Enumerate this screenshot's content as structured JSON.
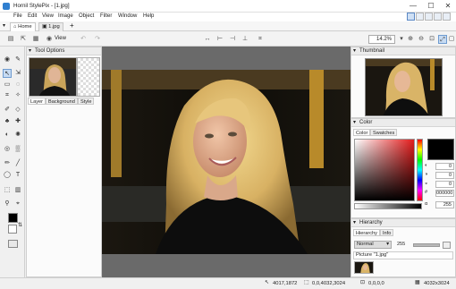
{
  "window": {
    "title": "Hornil StylePix - [1.jpg]",
    "minimize": "—",
    "maximize": "☐",
    "close": "✕"
  },
  "menu": [
    "File",
    "Edit",
    "View",
    "Image",
    "Object",
    "Filter",
    "Window",
    "Help"
  ],
  "doc_tabs": [
    {
      "label": "Home"
    },
    {
      "label": "1.jpg"
    }
  ],
  "tab_add": "+",
  "toolbar": {
    "view_label": "View",
    "zoom_value": "14.2%"
  },
  "tool_options": {
    "title": "Tool Options",
    "tabs": [
      "Layer",
      "Background",
      "Style"
    ]
  },
  "thumbnail": {
    "title": "Thumbnail"
  },
  "color": {
    "title": "Color",
    "tabs": [
      "Color",
      "Swatches"
    ],
    "foreground": "#000000",
    "hex_value": "000000",
    "channel_values": [
      "0",
      "0",
      "0",
      "0",
      "0",
      "255"
    ]
  },
  "hierarchy": {
    "title": "Hierarchy",
    "tabs": [
      "Hierarchy",
      "Info"
    ],
    "blend_mode": "Normal",
    "opacity": "255",
    "item": "Picture \"1.jpg\""
  },
  "status": {
    "cursor_pos": "4017,1872",
    "selection": "0,0,4032,3024",
    "offset": "0,0,0,0",
    "image_size": "4032x3024"
  },
  "colors": {
    "accent": "#2f7fd0",
    "canvas_bg": "#6a6a6a"
  }
}
